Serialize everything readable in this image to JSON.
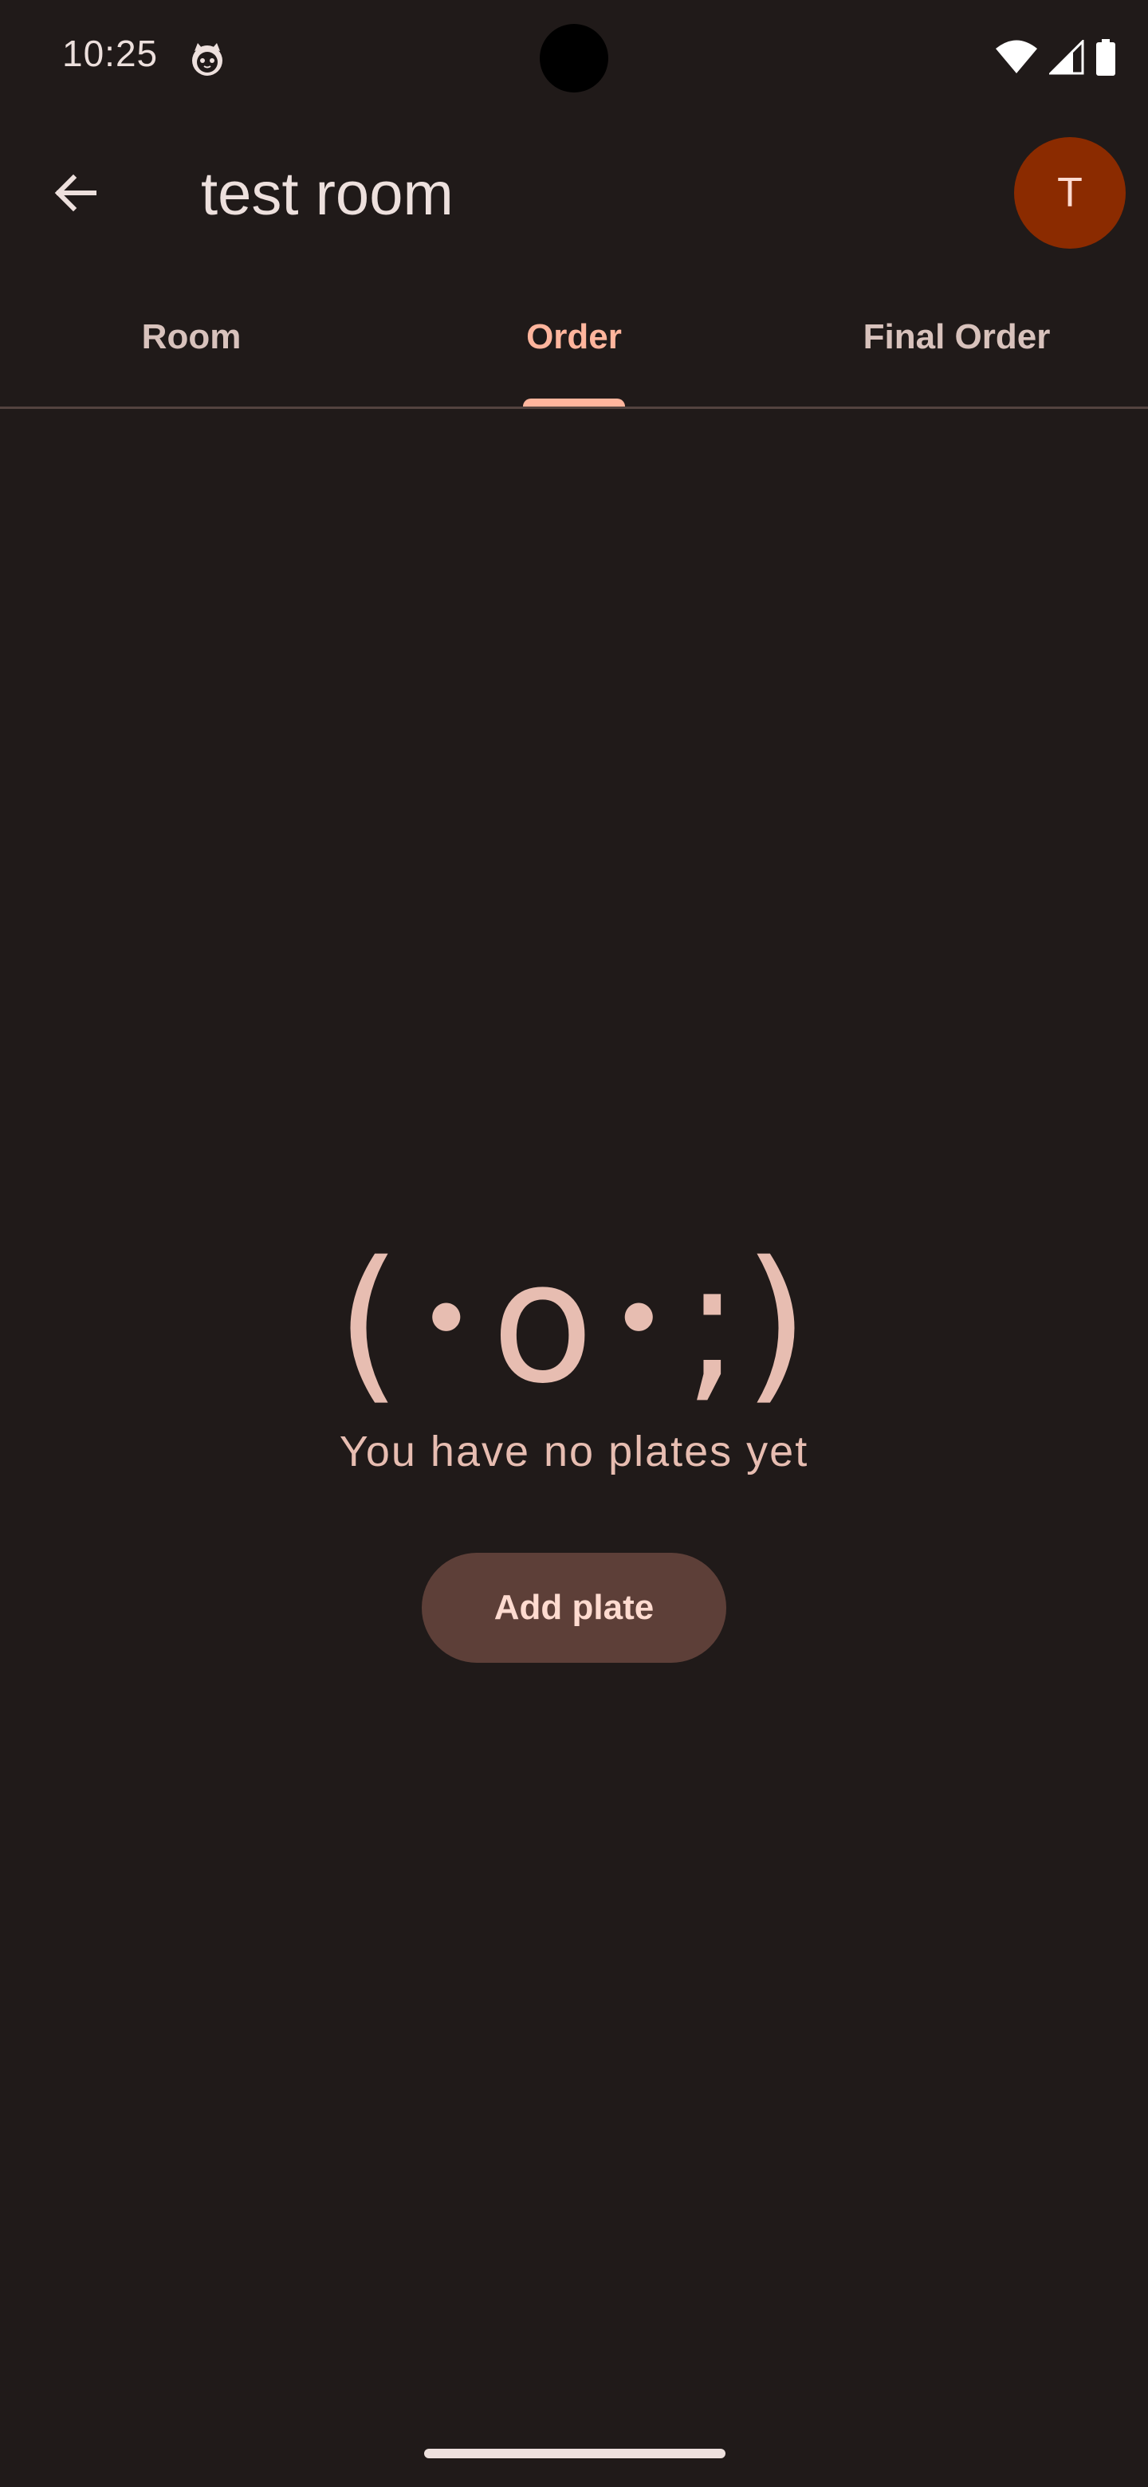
{
  "status_bar": {
    "time": "10:25",
    "app_icon": "cat-face-icon",
    "icons": [
      "wifi-icon",
      "cellular-signal-icon",
      "battery-icon"
    ]
  },
  "app_bar": {
    "back_icon": "arrow-back-icon",
    "title": "test room",
    "avatar_initial": "T"
  },
  "tabs": [
    {
      "label": "Room",
      "active": false
    },
    {
      "label": "Order",
      "active": true
    },
    {
      "label": "Final Order",
      "active": false
    }
  ],
  "empty_state": {
    "kaomoji": "(･o･;)",
    "message": "You have no plates yet",
    "button_label": "Add plate"
  },
  "colors": {
    "background": "#201a19",
    "accent": "#ffb59d",
    "avatar": "#8b2b00",
    "button": "#5d3f38",
    "empty_text": "#e7bdb1"
  }
}
